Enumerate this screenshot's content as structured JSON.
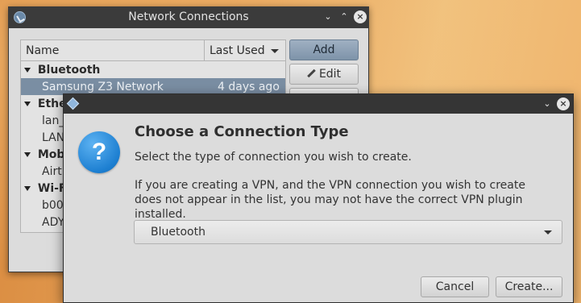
{
  "main_window": {
    "title": "Network Connections",
    "columns": {
      "name": "Name",
      "last_used": "Last Used"
    },
    "groups": [
      {
        "label": "Bluetooth",
        "items": [
          {
            "name": "Samsung Z3 Network",
            "last_used": "4 days ago",
            "selected": true
          }
        ]
      },
      {
        "label": "Ether",
        "items": [
          {
            "name": "lan_"
          },
          {
            "name": "LAN"
          }
        ]
      },
      {
        "label": "Mobil",
        "items": [
          {
            "name": "Airt"
          }
        ]
      },
      {
        "label": "Wi-Fi",
        "items": [
          {
            "name": "b00"
          },
          {
            "name": "ADY"
          }
        ]
      }
    ],
    "buttons": {
      "add": "Add",
      "edit": "Edit"
    }
  },
  "dialog": {
    "heading": "Choose a Connection Type",
    "subtitle": "Select the type of connection you wish to create.",
    "info": "If you are creating a VPN, and the VPN connection you wish to create does not appear in the list, you may not have the correct VPN plugin installed.",
    "icon_glyph": "?",
    "connection_type": "Bluetooth",
    "buttons": {
      "cancel": "Cancel",
      "create": "Create..."
    }
  },
  "colors": {
    "titlebar": "#3b3b3b",
    "selection": "#7a8ea3",
    "question_icon": "#1d7fd1"
  }
}
